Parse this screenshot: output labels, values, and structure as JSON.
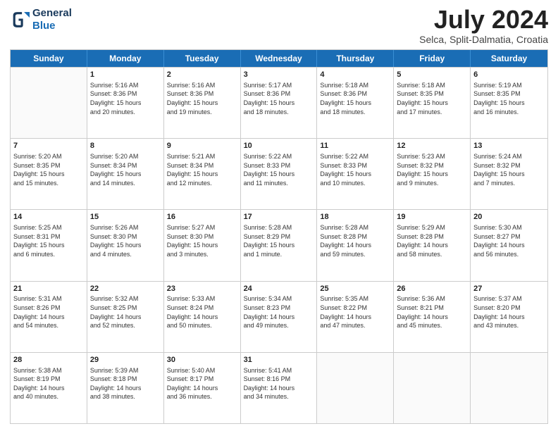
{
  "header": {
    "logo_line1": "General",
    "logo_line2": "Blue",
    "month": "July 2024",
    "location": "Selca, Split-Dalmatia, Croatia"
  },
  "weekdays": [
    "Sunday",
    "Monday",
    "Tuesday",
    "Wednesday",
    "Thursday",
    "Friday",
    "Saturday"
  ],
  "rows": [
    [
      {
        "day": "",
        "text": ""
      },
      {
        "day": "1",
        "text": "Sunrise: 5:16 AM\nSunset: 8:36 PM\nDaylight: 15 hours\nand 20 minutes."
      },
      {
        "day": "2",
        "text": "Sunrise: 5:16 AM\nSunset: 8:36 PM\nDaylight: 15 hours\nand 19 minutes."
      },
      {
        "day": "3",
        "text": "Sunrise: 5:17 AM\nSunset: 8:36 PM\nDaylight: 15 hours\nand 18 minutes."
      },
      {
        "day": "4",
        "text": "Sunrise: 5:18 AM\nSunset: 8:36 PM\nDaylight: 15 hours\nand 18 minutes."
      },
      {
        "day": "5",
        "text": "Sunrise: 5:18 AM\nSunset: 8:35 PM\nDaylight: 15 hours\nand 17 minutes."
      },
      {
        "day": "6",
        "text": "Sunrise: 5:19 AM\nSunset: 8:35 PM\nDaylight: 15 hours\nand 16 minutes."
      }
    ],
    [
      {
        "day": "7",
        "text": "Sunrise: 5:20 AM\nSunset: 8:35 PM\nDaylight: 15 hours\nand 15 minutes."
      },
      {
        "day": "8",
        "text": "Sunrise: 5:20 AM\nSunset: 8:34 PM\nDaylight: 15 hours\nand 14 minutes."
      },
      {
        "day": "9",
        "text": "Sunrise: 5:21 AM\nSunset: 8:34 PM\nDaylight: 15 hours\nand 12 minutes."
      },
      {
        "day": "10",
        "text": "Sunrise: 5:22 AM\nSunset: 8:33 PM\nDaylight: 15 hours\nand 11 minutes."
      },
      {
        "day": "11",
        "text": "Sunrise: 5:22 AM\nSunset: 8:33 PM\nDaylight: 15 hours\nand 10 minutes."
      },
      {
        "day": "12",
        "text": "Sunrise: 5:23 AM\nSunset: 8:32 PM\nDaylight: 15 hours\nand 9 minutes."
      },
      {
        "day": "13",
        "text": "Sunrise: 5:24 AM\nSunset: 8:32 PM\nDaylight: 15 hours\nand 7 minutes."
      }
    ],
    [
      {
        "day": "14",
        "text": "Sunrise: 5:25 AM\nSunset: 8:31 PM\nDaylight: 15 hours\nand 6 minutes."
      },
      {
        "day": "15",
        "text": "Sunrise: 5:26 AM\nSunset: 8:30 PM\nDaylight: 15 hours\nand 4 minutes."
      },
      {
        "day": "16",
        "text": "Sunrise: 5:27 AM\nSunset: 8:30 PM\nDaylight: 15 hours\nand 3 minutes."
      },
      {
        "day": "17",
        "text": "Sunrise: 5:28 AM\nSunset: 8:29 PM\nDaylight: 15 hours\nand 1 minute."
      },
      {
        "day": "18",
        "text": "Sunrise: 5:28 AM\nSunset: 8:28 PM\nDaylight: 14 hours\nand 59 minutes."
      },
      {
        "day": "19",
        "text": "Sunrise: 5:29 AM\nSunset: 8:28 PM\nDaylight: 14 hours\nand 58 minutes."
      },
      {
        "day": "20",
        "text": "Sunrise: 5:30 AM\nSunset: 8:27 PM\nDaylight: 14 hours\nand 56 minutes."
      }
    ],
    [
      {
        "day": "21",
        "text": "Sunrise: 5:31 AM\nSunset: 8:26 PM\nDaylight: 14 hours\nand 54 minutes."
      },
      {
        "day": "22",
        "text": "Sunrise: 5:32 AM\nSunset: 8:25 PM\nDaylight: 14 hours\nand 52 minutes."
      },
      {
        "day": "23",
        "text": "Sunrise: 5:33 AM\nSunset: 8:24 PM\nDaylight: 14 hours\nand 50 minutes."
      },
      {
        "day": "24",
        "text": "Sunrise: 5:34 AM\nSunset: 8:23 PM\nDaylight: 14 hours\nand 49 minutes."
      },
      {
        "day": "25",
        "text": "Sunrise: 5:35 AM\nSunset: 8:22 PM\nDaylight: 14 hours\nand 47 minutes."
      },
      {
        "day": "26",
        "text": "Sunrise: 5:36 AM\nSunset: 8:21 PM\nDaylight: 14 hours\nand 45 minutes."
      },
      {
        "day": "27",
        "text": "Sunrise: 5:37 AM\nSunset: 8:20 PM\nDaylight: 14 hours\nand 43 minutes."
      }
    ],
    [
      {
        "day": "28",
        "text": "Sunrise: 5:38 AM\nSunset: 8:19 PM\nDaylight: 14 hours\nand 40 minutes."
      },
      {
        "day": "29",
        "text": "Sunrise: 5:39 AM\nSunset: 8:18 PM\nDaylight: 14 hours\nand 38 minutes."
      },
      {
        "day": "30",
        "text": "Sunrise: 5:40 AM\nSunset: 8:17 PM\nDaylight: 14 hours\nand 36 minutes."
      },
      {
        "day": "31",
        "text": "Sunrise: 5:41 AM\nSunset: 8:16 PM\nDaylight: 14 hours\nand 34 minutes."
      },
      {
        "day": "",
        "text": ""
      },
      {
        "day": "",
        "text": ""
      },
      {
        "day": "",
        "text": ""
      }
    ]
  ]
}
